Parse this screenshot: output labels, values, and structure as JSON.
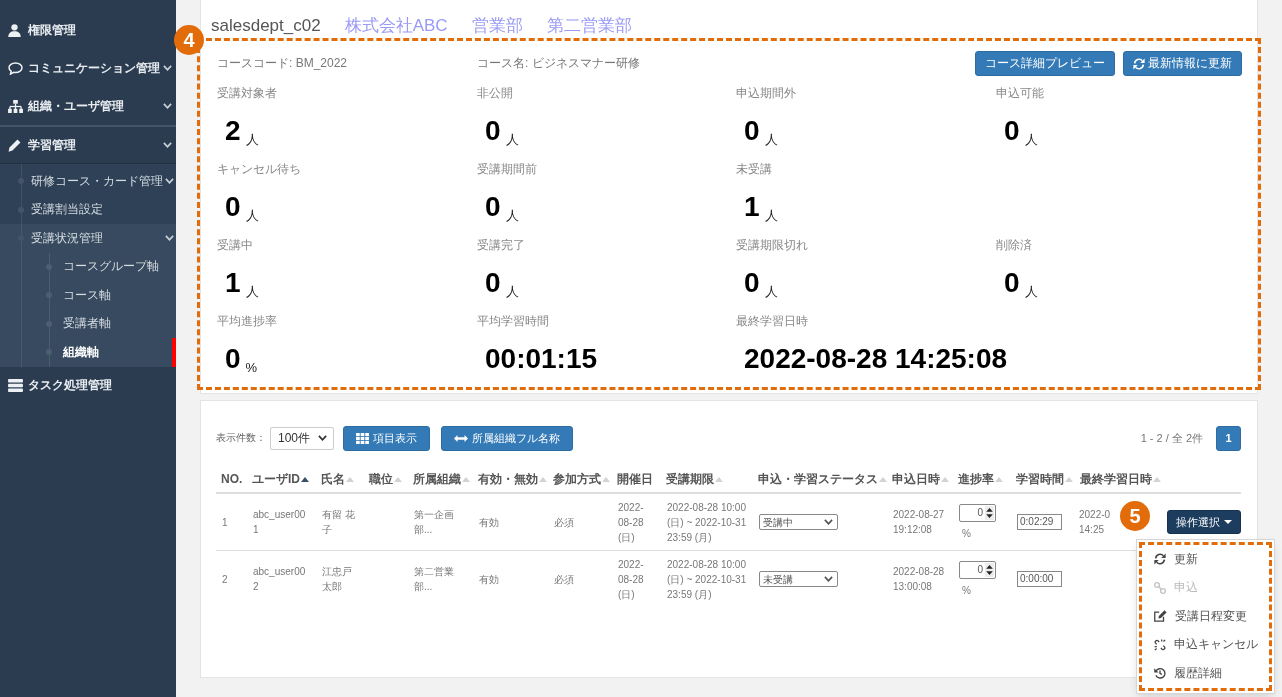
{
  "sidebar": {
    "items": [
      {
        "label": "権限管理",
        "kind": "link",
        "selected": false
      },
      {
        "label": "コミュニケーション管理",
        "kind": "group",
        "expanded": false,
        "selected": false
      },
      {
        "label": "組織・ユーザ管理",
        "kind": "group",
        "expanded": false,
        "selected": false
      },
      {
        "label": "学習管理",
        "kind": "group",
        "expanded": true,
        "selected": false,
        "children": [
          {
            "label": "研修コース・カード管理",
            "kind": "group",
            "expanded": false,
            "selected": false
          },
          {
            "label": "受講割当設定",
            "kind": "link",
            "selected": false
          },
          {
            "label": "受講状況管理",
            "kind": "group",
            "expanded": true,
            "selected": false,
            "children": [
              {
                "label": "コースグループ軸",
                "kind": "link",
                "selected": false
              },
              {
                "label": "コース軸",
                "kind": "link",
                "selected": false
              },
              {
                "label": "受講者軸",
                "kind": "link",
                "selected": false
              },
              {
                "label": "組織軸",
                "kind": "link",
                "selected": true
              }
            ]
          }
        ]
      },
      {
        "label": "タスク処理管理",
        "kind": "link",
        "selected": false
      }
    ]
  },
  "header": {
    "code": "salesdept_c02",
    "breadcrumb": [
      "株式会社ABC",
      "営業部",
      "第二営業部"
    ]
  },
  "summary": {
    "callout": "4",
    "course_code": "コースコード: BM_2022",
    "course_name": "コース名: ビジネスマナー研修",
    "buttons": [
      {
        "label": "コース詳細プレビュー"
      },
      {
        "label": "最新情報に更新"
      }
    ],
    "stat_rows": [
      [
        {
          "label": "受講対象者",
          "value": "2",
          "unit": "人"
        },
        {
          "label": "非公開",
          "value": "0",
          "unit": "人"
        },
        {
          "label": "申込期間外",
          "value": "0",
          "unit": "人"
        },
        {
          "label": "申込可能",
          "value": "0",
          "unit": "人"
        }
      ],
      [
        {
          "label": "キャンセル待ち",
          "value": "0",
          "unit": "人"
        },
        {
          "label": "受講期間前",
          "value": "0",
          "unit": "人"
        },
        {
          "label": "未受講",
          "value": "1",
          "unit": "人"
        }
      ],
      [
        {
          "label": "受講中",
          "value": "1",
          "unit": "人"
        },
        {
          "label": "受講完了",
          "value": "0",
          "unit": "人"
        },
        {
          "label": "受講期限切れ",
          "value": "0",
          "unit": "人"
        },
        {
          "label": "削除済",
          "value": "0",
          "unit": "人"
        }
      ],
      [
        {
          "label": "平均進捗率",
          "value": "0",
          "unit": "%"
        },
        {
          "label": "平均学習時間",
          "value": "00:01:15"
        },
        {
          "label": "最終学習日時",
          "value": "2022-08-28 14:25:08"
        }
      ]
    ]
  },
  "list": {
    "page_size": {
      "label": "表示件数：",
      "value": "100件"
    },
    "buttons": [
      "項目表示",
      "所属組織フル名称"
    ],
    "pagination": {
      "summary": "1 - 2 / 全 2件",
      "pages": [
        {
          "label": "1",
          "selected": true
        }
      ]
    },
    "table": {
      "columns": [
        {
          "label": "NO.",
          "sortable": false
        },
        {
          "label": "ユーザID",
          "sortable": true,
          "sorted": true
        },
        {
          "label": "氏名",
          "sortable": true,
          "sorted": false
        },
        {
          "label": "職位",
          "sortable": true,
          "sorted": false
        },
        {
          "label": "所属組織",
          "sortable": true,
          "sorted": false
        },
        {
          "label": "有効・無効",
          "sortable": true,
          "sorted": false
        },
        {
          "label": "参加方式",
          "sortable": true,
          "sorted": false
        },
        {
          "label": "開催日",
          "sortable": false
        },
        {
          "label": "受講期限",
          "sortable": true,
          "sorted": false
        },
        {
          "label": "申込・学習ステータス",
          "sortable": true,
          "sorted": false
        },
        {
          "label": "申込日時",
          "sortable": true,
          "sorted": false
        },
        {
          "label": "進捗率",
          "sortable": true,
          "sorted": false
        },
        {
          "label": "学習時間",
          "sortable": true,
          "sorted": false
        },
        {
          "label": "最終学習日時",
          "sortable": true,
          "sorted": false
        }
      ],
      "rows": [
        {
          "no": "1",
          "user_id": "abc_user001",
          "name": "有留 花子",
          "org": "第一企画部...",
          "validity": "有効",
          "participation": "必須",
          "held_on": "2022-08-28 (日)",
          "period": "2022-08-28 10:00 (日) ~ 2022-10-31 23:59 (月)",
          "status": "受講中",
          "applied_at": "2022-08-27 19:12:08",
          "progress": "0",
          "progress_unit": "%",
          "study_time": "0:02:29",
          "last_study": "2022-0 14:25",
          "action": {
            "label": "操作選択",
            "expanded": true
          }
        },
        {
          "no": "2",
          "user_id": "abc_user002",
          "name": "江忠戸太郎",
          "org": "第二営業部...",
          "validity": "有効",
          "participation": "必須",
          "held_on": "2022-08-28 (日)",
          "period": "2022-08-28 10:00 (日) ~ 2022-10-31 23:59 (月)",
          "status": "未受講",
          "applied_at": "2022-08-28 13:00:08",
          "progress": "0",
          "progress_unit": "%",
          "study_time": "0:00:00"
        }
      ],
      "action_menu": {
        "callout": "5",
        "items": [
          {
            "label": "更新",
            "disabled": false
          },
          {
            "label": "申込",
            "disabled": true
          },
          {
            "label": "受講日程変更",
            "disabled": false
          },
          {
            "label": "申込キャンセル",
            "disabled": false
          },
          {
            "label": "履歴詳細",
            "disabled": false
          }
        ]
      }
    }
  }
}
